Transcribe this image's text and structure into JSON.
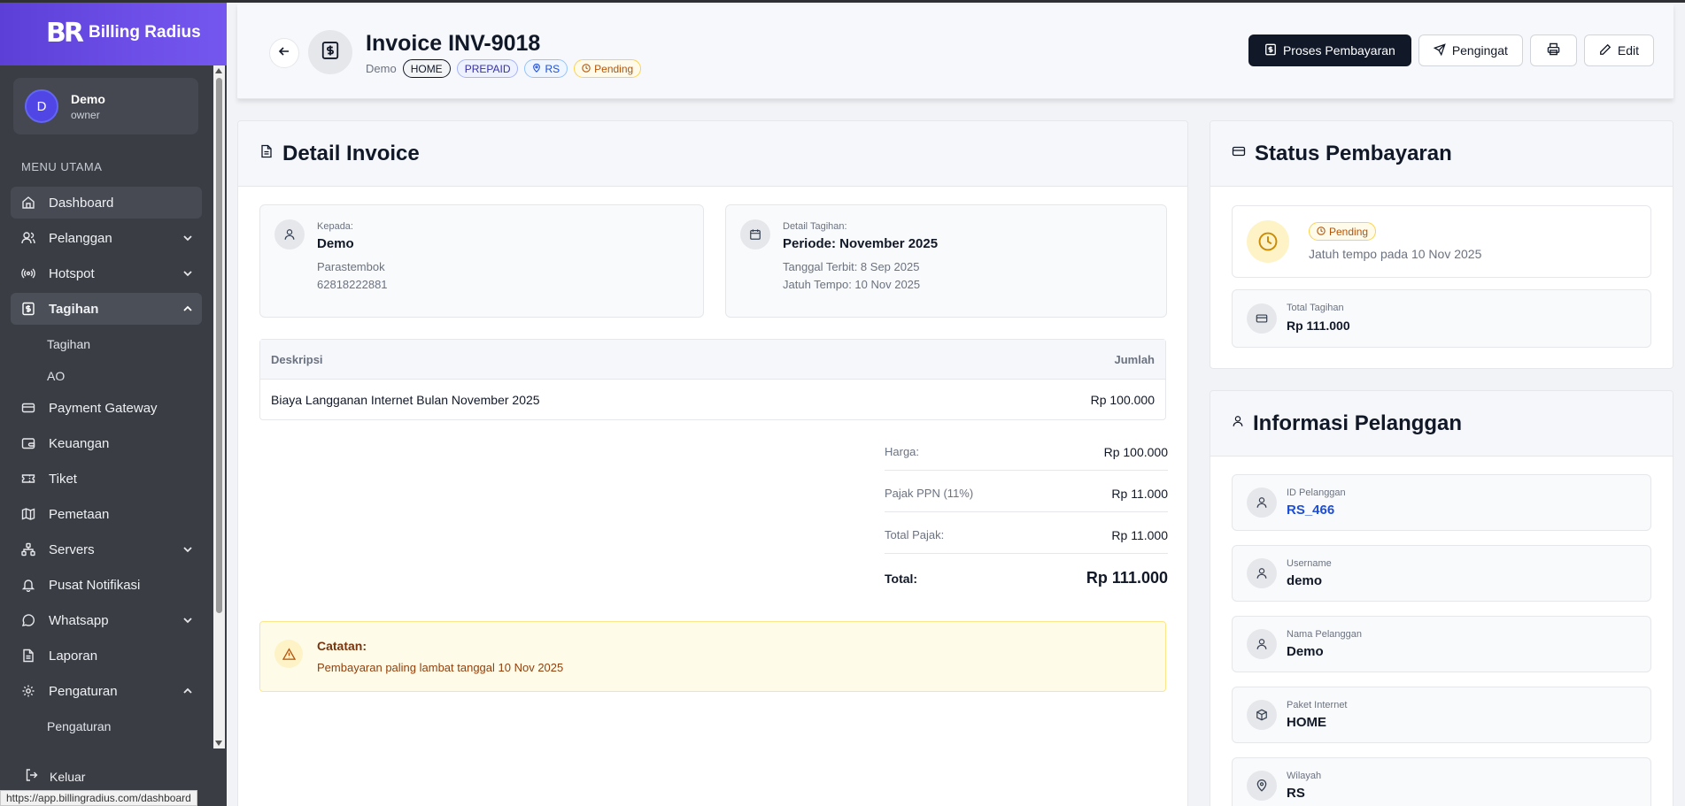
{
  "sidebar": {
    "brand_logo": "BR",
    "brand_name": "Billing Radius",
    "user": {
      "initial": "D",
      "name": "Demo",
      "role": "owner"
    },
    "menu_title": "MENU UTAMA",
    "items": [
      {
        "label": "Dashboard"
      },
      {
        "label": "Pelanggan"
      },
      {
        "label": "Hotspot"
      },
      {
        "label": "Tagihan"
      },
      {
        "label": "Payment Gateway"
      },
      {
        "label": "Keuangan"
      },
      {
        "label": "Tiket"
      },
      {
        "label": "Pemetaan"
      },
      {
        "label": "Servers"
      },
      {
        "label": "Pusat Notifikasi"
      },
      {
        "label": "Whatsapp"
      },
      {
        "label": "Laporan"
      },
      {
        "label": "Pengaturan"
      }
    ],
    "tagihan_sub": [
      "Tagihan",
      "AO"
    ],
    "pengaturan_sub": [
      "Pengaturan"
    ],
    "logout": "Keluar",
    "status_url": "https://app.billingradius.com/dashboard"
  },
  "header": {
    "title": "Invoice INV-9018",
    "customer": "Demo",
    "tags": {
      "plan": "HOME",
      "type": "PREPAID",
      "region": "RS",
      "status": "Pending"
    },
    "actions": {
      "process": "Proses Pembayaran",
      "reminder": "Pengingat",
      "edit": "Edit"
    }
  },
  "detail": {
    "title": "Detail Invoice",
    "to": {
      "label": "Kepada:",
      "name": "Demo",
      "address": "Parastembok",
      "phone": "62818222881"
    },
    "billing": {
      "label": "Detail Tagihan:",
      "period": "Periode: November 2025",
      "issued": "Tanggal Terbit: 8 Sep 2025",
      "due": "Jatuh Tempo: 10 Nov 2025"
    },
    "table": {
      "col_desc": "Deskripsi",
      "col_amount": "Jumlah",
      "rows": [
        {
          "desc": "Biaya Langganan Internet Bulan November 2025",
          "amount": "Rp 100.000"
        }
      ]
    },
    "summary": {
      "price_label": "Harga:",
      "price": "Rp 100.000",
      "tax_label": "Pajak PPN (11%)",
      "tax": "Rp 11.000",
      "total_tax_label": "Total Pajak:",
      "total_tax": "Rp 11.000",
      "total_label": "Total:",
      "total": "Rp 111.000"
    },
    "note": {
      "title": "Catatan:",
      "text": "Pembayaran paling lambat tanggal 10 Nov 2025"
    }
  },
  "payment_status": {
    "title": "Status Pembayaran",
    "badge": "Pending",
    "due_text": "Jatuh tempo pada 10 Nov 2025",
    "total_label": "Total Tagihan",
    "total": "Rp 111.000"
  },
  "customer_info": {
    "title": "Informasi Pelanggan",
    "fields": [
      {
        "label": "ID Pelanggan",
        "value": "RS_466"
      },
      {
        "label": "Username",
        "value": "demo"
      },
      {
        "label": "Nama Pelanggan",
        "value": "Demo"
      },
      {
        "label": "Paket Internet",
        "value": "HOME"
      },
      {
        "label": "Wilayah",
        "value": "RS"
      }
    ]
  },
  "colors": {
    "brand": "#6d4fe8",
    "sidebar": "#3a3d44",
    "pending": "#b45309",
    "link": "#1d4ed8"
  }
}
